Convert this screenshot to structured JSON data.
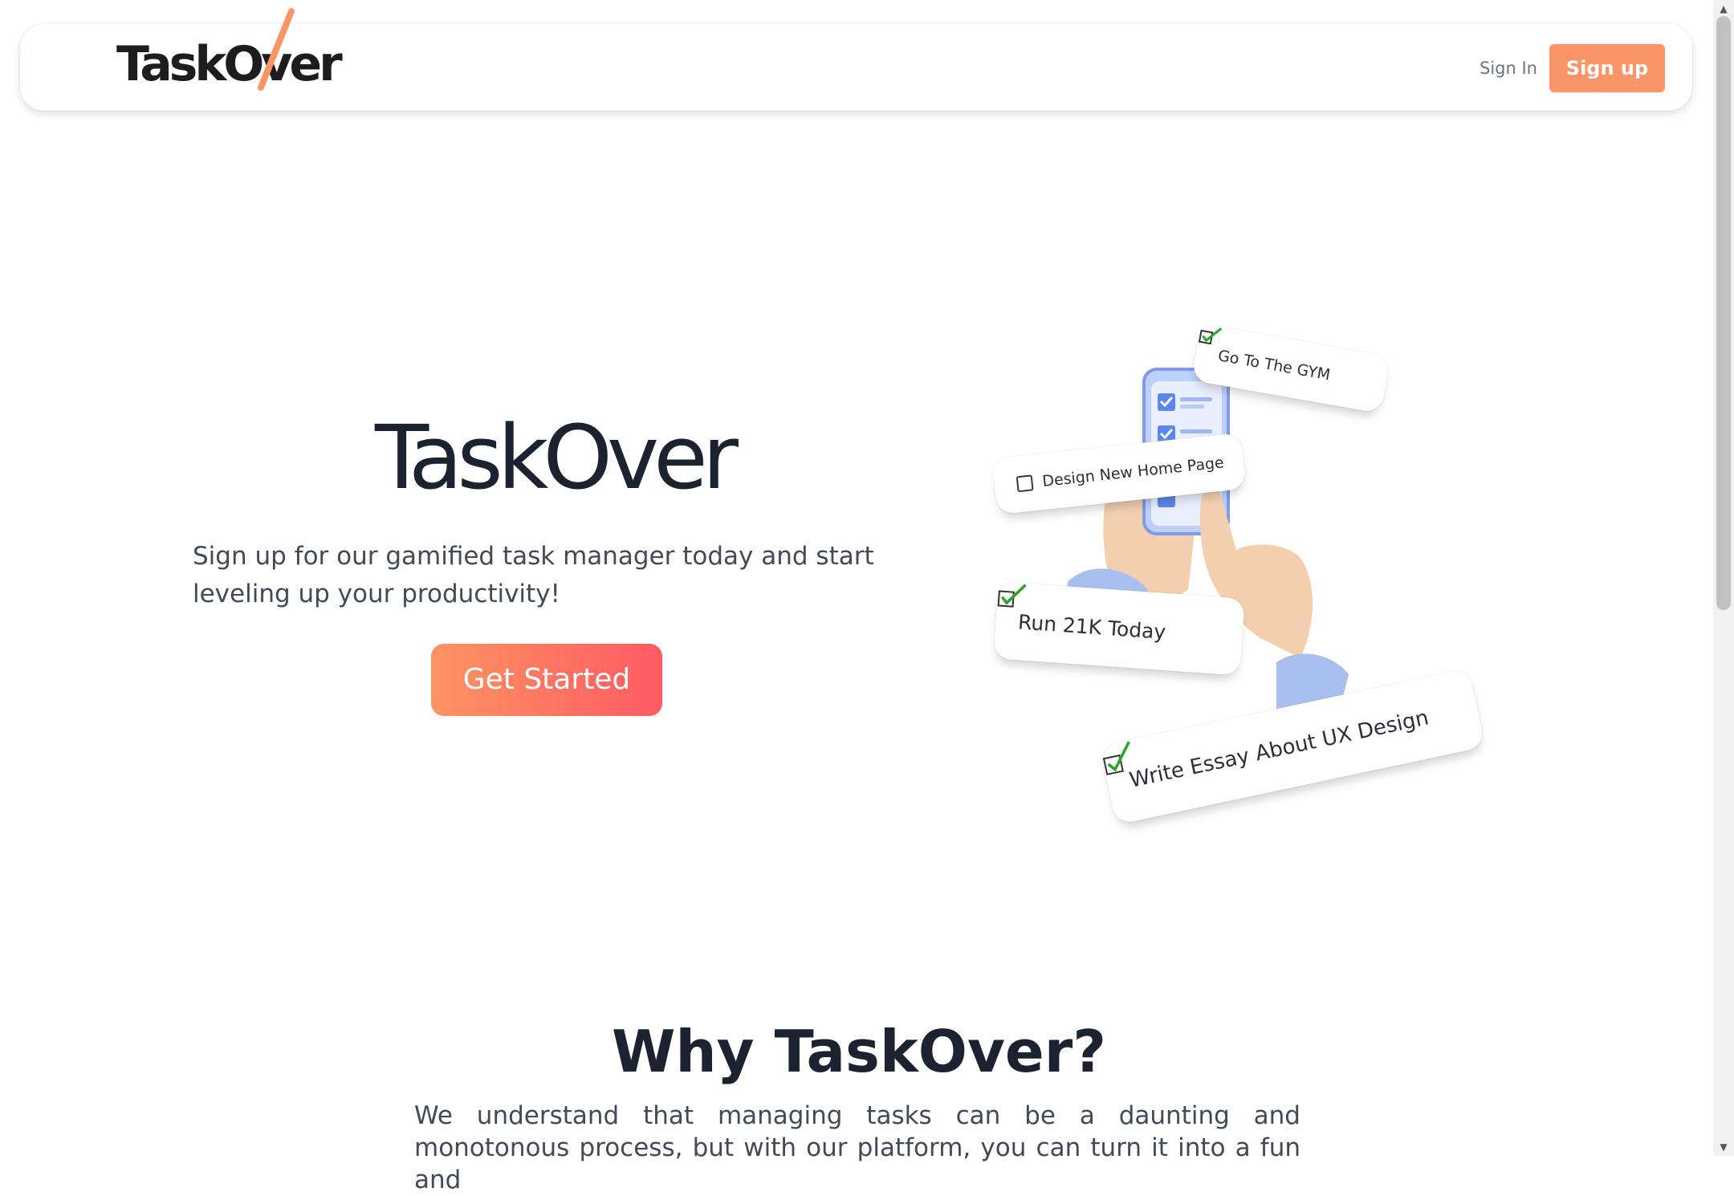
{
  "nav": {
    "logo_text": "TaskOver",
    "signin_label": "Sign In",
    "signup_label": "Sign up"
  },
  "hero": {
    "title": "TaskOver",
    "subtitle": "Sign up for our gamified task manager today and start leveling up your productivity!",
    "cta_label": "Get Started"
  },
  "illustration": {
    "tasks": [
      {
        "label": "Go To The GYM",
        "done": true
      },
      {
        "label": "Design New Home Page",
        "done": false
      },
      {
        "label": "Run 21K Today",
        "done": true
      },
      {
        "label": "Write Essay About UX Design",
        "done": true
      }
    ]
  },
  "why": {
    "title": "Why TaskOver?",
    "text": "We understand that managing tasks can be a daunting and monotonous process, but with our platform, you can turn it into a fun and"
  },
  "colors": {
    "accent": "#fb9567",
    "cta_gradient_start": "#fe9462",
    "cta_gradient_end": "#ff5a63",
    "check_green": "#2aa52a",
    "text_dark": "#1b2230"
  }
}
